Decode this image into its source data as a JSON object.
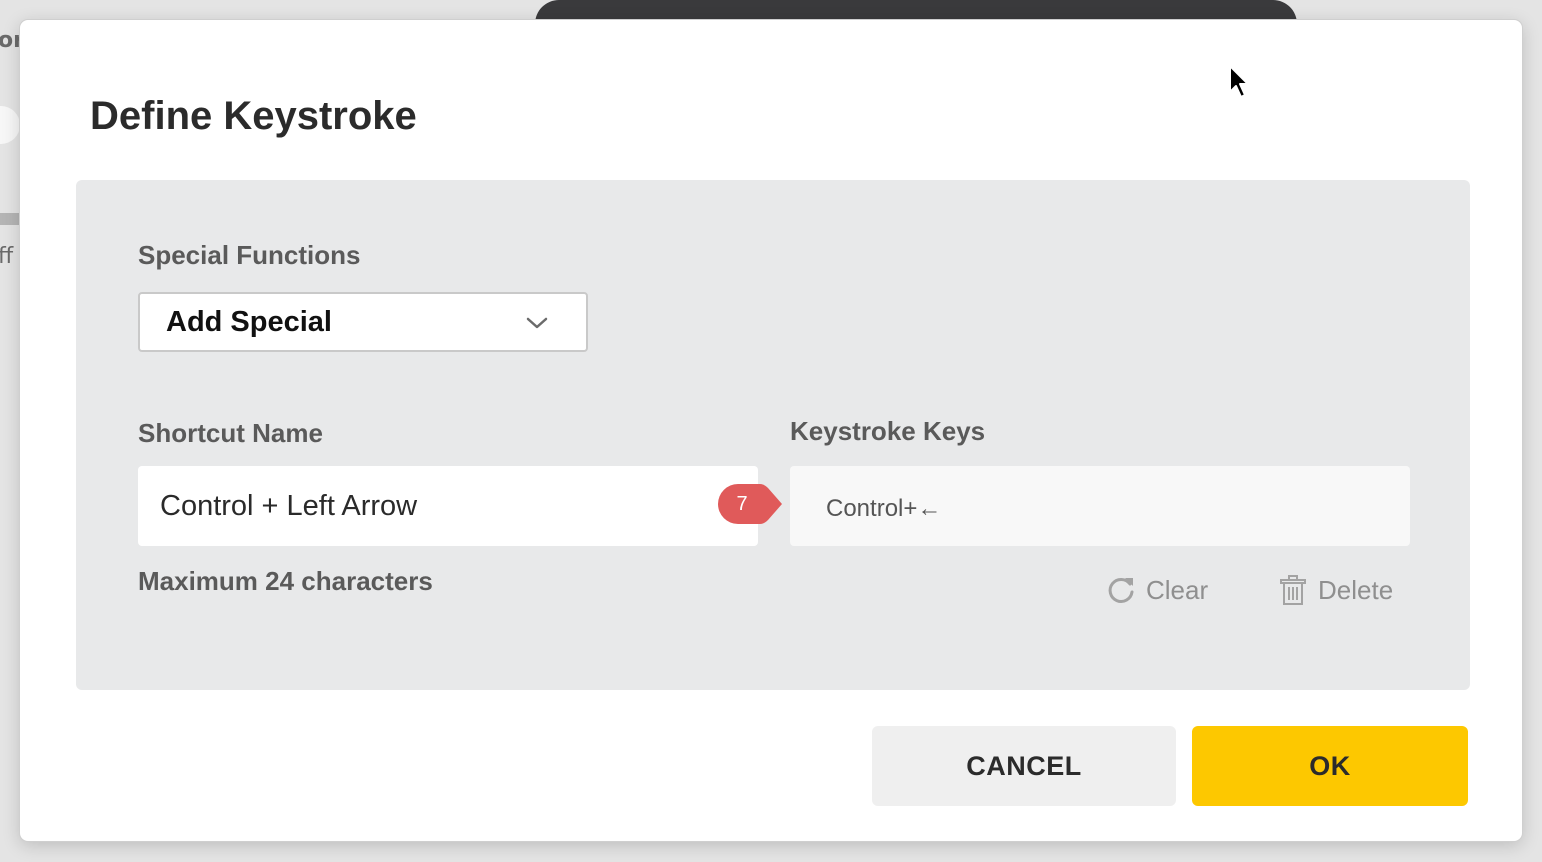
{
  "background": {
    "text_top": "or",
    "text_mid": "ff"
  },
  "dialog": {
    "title": "Define Keystroke",
    "special_functions": {
      "label": "Special Functions",
      "selected": "Add Special"
    },
    "shortcut_name": {
      "label": "Shortcut Name",
      "value": "Control + Left Arrow",
      "hint": "Maximum 24 characters"
    },
    "keystroke_keys": {
      "label": "Keystroke Keys",
      "value": "Control+←"
    },
    "step_badge": "7",
    "actions": {
      "clear": "Clear",
      "delete": "Delete"
    },
    "buttons": {
      "cancel": "CANCEL",
      "ok": "OK"
    }
  },
  "colors": {
    "accent_ok": "#fdc800",
    "badge": "#e05a5a",
    "panel": "#e8e9ea"
  },
  "icons": {
    "dropdown": "chevron-down-icon",
    "clear": "refresh-icon",
    "delete": "trash-icon",
    "pointer": "mouse-cursor-icon"
  }
}
